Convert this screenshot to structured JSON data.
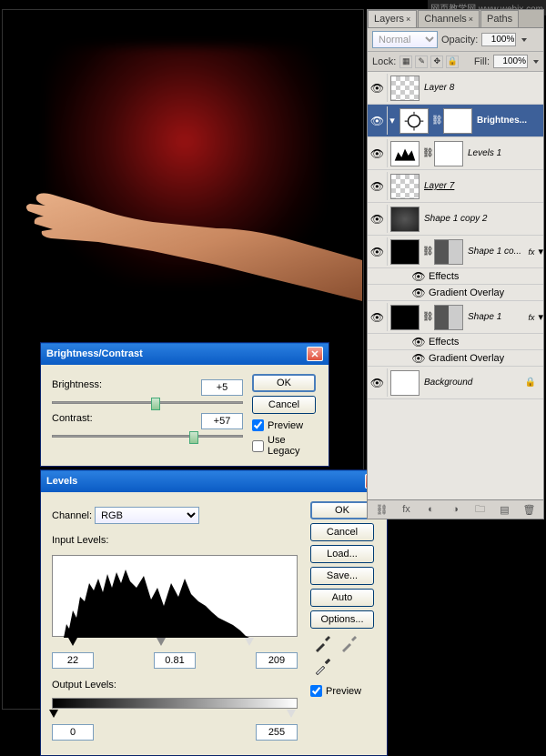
{
  "watermark": "网页教学网 www.webjx.com",
  "dialogs": {
    "bc": {
      "title": "Brightness/Contrast",
      "brightness_label": "Brightness:",
      "brightness_value": "+5",
      "contrast_label": "Contrast:",
      "contrast_value": "+57",
      "ok": "OK",
      "cancel": "Cancel",
      "preview": "Preview",
      "legacy": "Use Legacy"
    },
    "levels": {
      "title": "Levels",
      "channel_label": "Channel:",
      "channel_value": "RGB",
      "input_label": "Input Levels:",
      "in_black": "22",
      "in_gamma": "0.81",
      "in_white": "209",
      "output_label": "Output Levels:",
      "out_black": "0",
      "out_white": "255",
      "ok": "OK",
      "cancel": "Cancel",
      "load": "Load...",
      "save": "Save...",
      "auto": "Auto",
      "options": "Options...",
      "preview": "Preview"
    }
  },
  "panel": {
    "tabs": {
      "layers": "Layers",
      "channels": "Channels",
      "paths": "Paths"
    },
    "blend": "Normal",
    "opacity_label": "Opacity:",
    "opacity": "100%",
    "lock_label": "Lock:",
    "fill_label": "Fill:",
    "fill": "100%",
    "layers": [
      {
        "name": "Layer 8"
      },
      {
        "name": "Brightnes..."
      },
      {
        "name": "Levels 1"
      },
      {
        "name": "Layer 7"
      },
      {
        "name": "Shape 1 copy 2"
      },
      {
        "name": "Shape 1 co..."
      },
      {
        "name": "Shape 1"
      },
      {
        "name": "Background"
      }
    ],
    "effects": "Effects",
    "grad": "Gradient Overlay"
  }
}
